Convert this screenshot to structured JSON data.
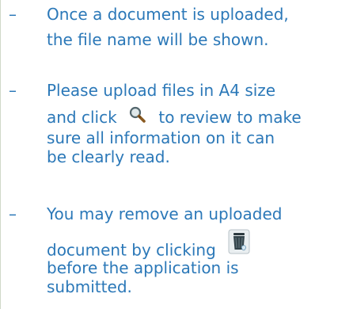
{
  "notes": [
    {
      "dash": "–",
      "lines": [
        "Once a document is uploaded,",
        "the file name will be shown."
      ]
    },
    {
      "dash": "–",
      "lines": [
        "Please upload files in A4 size",
        "and click",
        "to review to make",
        "sure all information on it can",
        "be clearly read."
      ],
      "icon": "magnifier-icon"
    },
    {
      "dash": "–",
      "lines": [
        "You may remove an uploaded",
        "document by clicking",
        "before the application is",
        "submitted."
      ],
      "icon": "trash-bin-icon"
    }
  ]
}
